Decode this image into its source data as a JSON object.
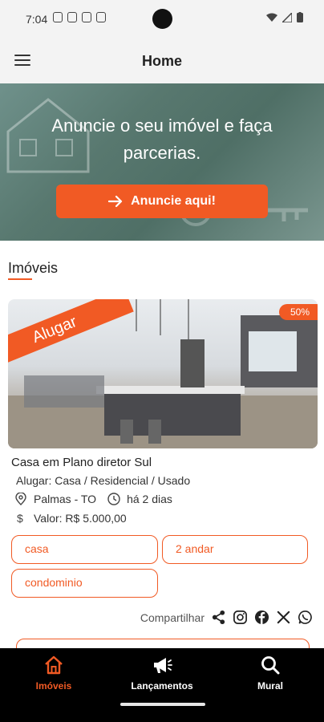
{
  "status": {
    "time": "7:04"
  },
  "app_bar": {
    "title": "Home"
  },
  "hero": {
    "text": "Anuncie o seu imóvel e faça parcerias.",
    "button": "Anuncie aqui!"
  },
  "section": {
    "title": "Imóveis"
  },
  "listing": {
    "ribbon": "Alugar",
    "badge": "50%",
    "title": "Casa em Plano diretor Sul",
    "subtitle": "Alugar: Casa / Residencial / Usado",
    "location": "Palmas - TO",
    "time": "há 2 dias",
    "value": "Valor: R$ 5.000,00",
    "tags": [
      "casa",
      "2 andar",
      "condominio"
    ],
    "share_label": "Compartilhar"
  },
  "nav": {
    "items": [
      {
        "label": "Imóveis",
        "icon": "home-icon",
        "active": true
      },
      {
        "label": "Lançamentos",
        "icon": "megaphone-icon",
        "active": false
      },
      {
        "label": "Mural",
        "icon": "search-icon",
        "active": false
      }
    ]
  },
  "colors": {
    "accent": "#f15a24",
    "nav_bg": "#000000",
    "bar_bg": "#f3f3f3"
  }
}
